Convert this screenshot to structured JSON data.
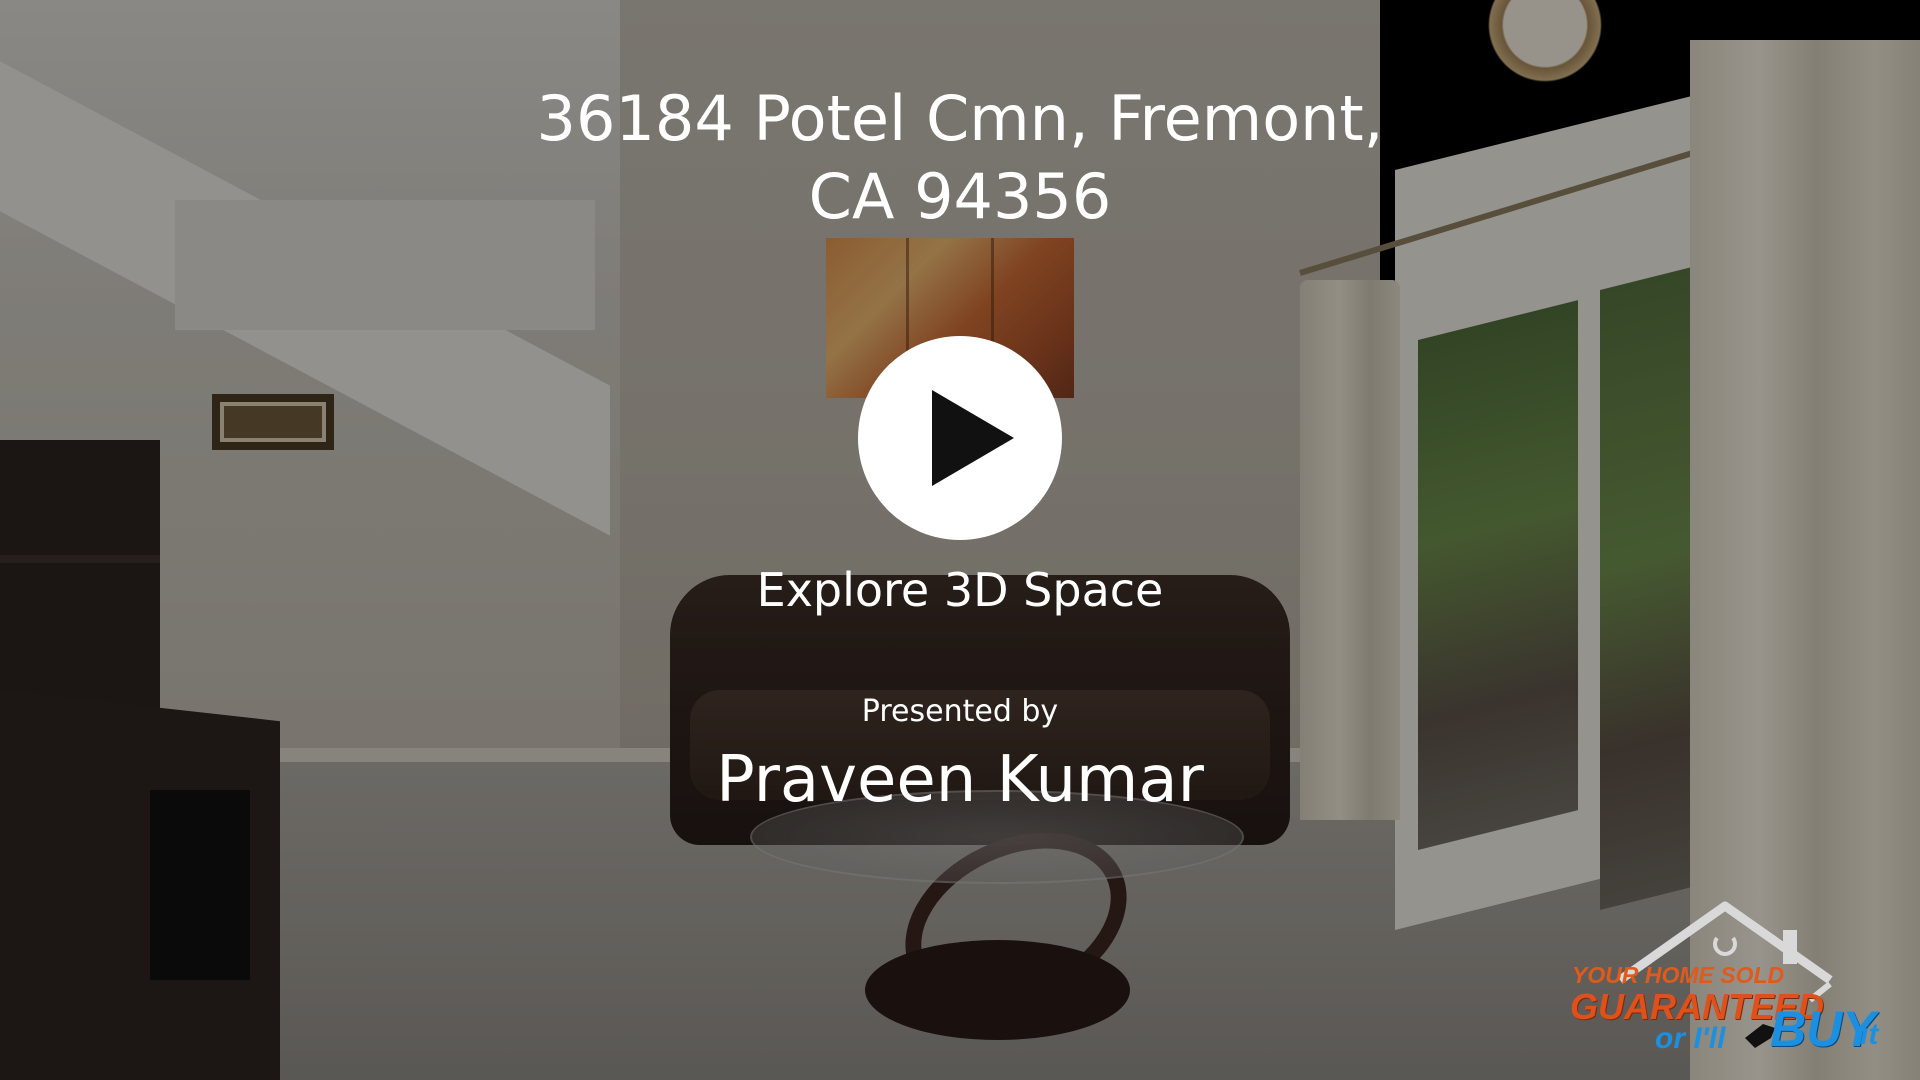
{
  "listing": {
    "address_line1": "36184 Potel Cmn, Fremont,",
    "address_line2": "CA 94356"
  },
  "player": {
    "play_icon": "play-icon"
  },
  "explore_label": "Explore 3D Space",
  "presenter": {
    "prefix": "Presented by",
    "name": "Praveen Kumar"
  },
  "logo": {
    "line1": "YOUR HOME SOLD",
    "line2": "GUARANTEED",
    "line3": "or I'll",
    "line4": "BUY",
    "line5": "it",
    "colors": {
      "orange": "#e0501a",
      "blue": "#1c8fe0"
    }
  },
  "colors": {
    "overlay_text": "#ffffff",
    "play_button_bg": "#ffffff",
    "play_icon": "#111111"
  }
}
